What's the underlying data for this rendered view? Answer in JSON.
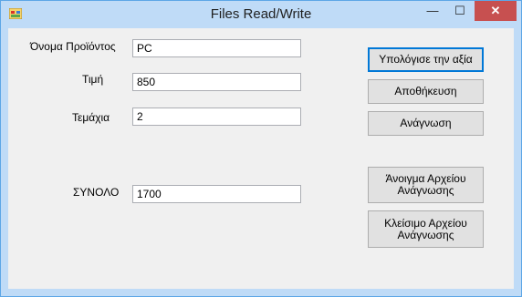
{
  "window": {
    "title": "Files Read/Write",
    "accent": "#bfdbf7",
    "close_color": "#c75050"
  },
  "controls": {
    "minimize": "—",
    "maximize": "☐",
    "close": "✕"
  },
  "labels": {
    "product_name": "Όνομα Προϊόντος",
    "price": "Τιμή",
    "quantity": "Τεμάχια",
    "total": "ΣΥΝΟΛΟ"
  },
  "fields": {
    "product_name": "PC",
    "price": "850",
    "quantity": "2",
    "total": "1700"
  },
  "buttons": {
    "calculate": "Υπολόγισε την αξία",
    "save": "Αποθήκευση",
    "read": "Ανάγνωση",
    "open_read_file": [
      "Άνοιγμα Αρχείου",
      "Ανάγνωσης"
    ],
    "close_read_file": [
      "Κλείσιμο Αρχείου",
      "Ανάγνωσης"
    ]
  }
}
